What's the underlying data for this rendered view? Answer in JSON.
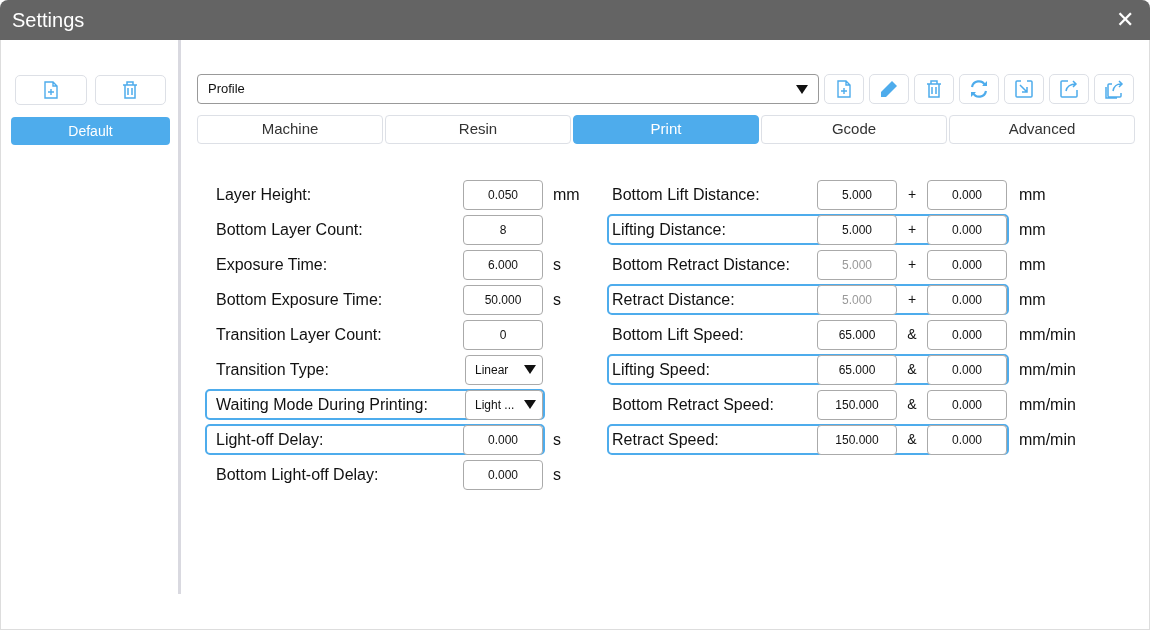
{
  "window": {
    "title": "Settings",
    "close": "✕"
  },
  "sidebar": {
    "items": [
      {
        "label": "Default",
        "selected": true
      }
    ]
  },
  "profile": {
    "value": "Profile"
  },
  "tabs": [
    {
      "label": "Machine",
      "selected": false
    },
    {
      "label": "Resin",
      "selected": false
    },
    {
      "label": "Print",
      "selected": true
    },
    {
      "label": "Gcode",
      "selected": false
    },
    {
      "label": "Advanced",
      "selected": false
    }
  ],
  "left_settings": [
    {
      "kind": "input",
      "label": "Layer Height:",
      "value": "0.050",
      "unit": "mm",
      "highlighted": false
    },
    {
      "kind": "input",
      "label": "Bottom Layer Count:",
      "value": "8",
      "highlighted": false
    },
    {
      "kind": "input",
      "label": "Exposure Time:",
      "value": "6.000",
      "unit": "s",
      "highlighted": false
    },
    {
      "kind": "input",
      "label": "Bottom Exposure Time:",
      "value": "50.000",
      "unit": "s",
      "highlighted": false
    },
    {
      "kind": "input",
      "label": "Transition Layer Count:",
      "value": "0",
      "highlighted": false
    },
    {
      "kind": "dropdown",
      "label": "Transition Type:",
      "value": "Linear",
      "highlighted": false
    },
    {
      "kind": "dropdown",
      "label": "Waiting Mode During Printing:",
      "value": "Light ...",
      "highlighted": true
    },
    {
      "kind": "input",
      "label": "Light-off Delay:",
      "value": "0.000",
      "unit": "s",
      "highlighted": true
    },
    {
      "kind": "input",
      "label": "Bottom Light-off Delay:",
      "value": "0.000",
      "unit": "s",
      "highlighted": false
    }
  ],
  "right_settings": [
    {
      "label": "Bottom Lift Distance:",
      "value": "5.000",
      "disabled": false,
      "operator": "+",
      "value_2": "0.000",
      "unit": "mm",
      "highlighted": false
    },
    {
      "label": "Lifting Distance:",
      "value": "5.000",
      "disabled": false,
      "operator": "+",
      "value_2": "0.000",
      "unit": "mm",
      "highlighted": true
    },
    {
      "label": "Bottom Retract Distance:",
      "value": "5.000",
      "disabled": true,
      "operator": "+",
      "value_2": "0.000",
      "unit": "mm",
      "highlighted": false
    },
    {
      "label": "Retract Distance:",
      "value": "5.000",
      "disabled": true,
      "operator": "+",
      "value_2": "0.000",
      "unit": "mm",
      "highlighted": true
    },
    {
      "label": "Bottom Lift Speed:",
      "value": "65.000",
      "disabled": false,
      "operator": "&",
      "value_2": "0.000",
      "unit": "mm/min",
      "highlighted": false
    },
    {
      "label": "Lifting Speed:",
      "value": "65.000",
      "disabled": false,
      "operator": "&",
      "value_2": "0.000",
      "unit": "mm/min",
      "highlighted": true
    },
    {
      "label": "Bottom Retract Speed:",
      "value": "150.000",
      "disabled": false,
      "operator": "&",
      "value_2": "0.000",
      "unit": "mm/min",
      "highlighted": false
    },
    {
      "label": "Retract Speed:",
      "value": "150.000",
      "disabled": false,
      "operator": "&",
      "value_2": "0.000",
      "unit": "mm/min",
      "highlighted": true
    }
  ]
}
